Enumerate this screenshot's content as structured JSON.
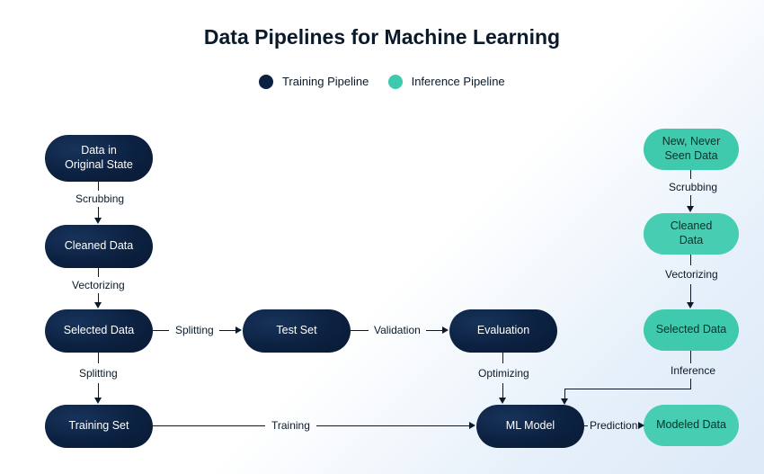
{
  "title": "Data Pipelines for Machine Learning",
  "legend": {
    "training": {
      "label": "Training Pipeline",
      "color": "#0c2141"
    },
    "inference": {
      "label": "Inference Pipeline",
      "color": "#3fc9ad"
    }
  },
  "nodes": {
    "original": {
      "label": "Data in\nOriginal State"
    },
    "cleaned": {
      "label": "Cleaned Data"
    },
    "selected": {
      "label": "Selected Data"
    },
    "testset": {
      "label": "Test Set"
    },
    "evaluation": {
      "label": "Evaluation"
    },
    "training": {
      "label": "Training Set"
    },
    "mlmodel": {
      "label": "ML Model"
    },
    "newdata": {
      "label": "New, Never\nSeen Data"
    },
    "cleaned2": {
      "label": "Cleaned\nData"
    },
    "selected2": {
      "label": "Selected Data"
    },
    "modeled": {
      "label": "Modeled Data"
    }
  },
  "edges": {
    "scrub1": {
      "label": "Scrubbing"
    },
    "vect1": {
      "label": "Vectorizing"
    },
    "split_h": {
      "label": "Splitting"
    },
    "split_v": {
      "label": "Splitting"
    },
    "valid": {
      "label": "Validation"
    },
    "optim": {
      "label": "Optimizing"
    },
    "train": {
      "label": "Training"
    },
    "predict": {
      "label": "Prediction"
    },
    "scrub2": {
      "label": "Scrubbing"
    },
    "vect2": {
      "label": "Vectorizing"
    },
    "infer": {
      "label": "Inference"
    }
  }
}
